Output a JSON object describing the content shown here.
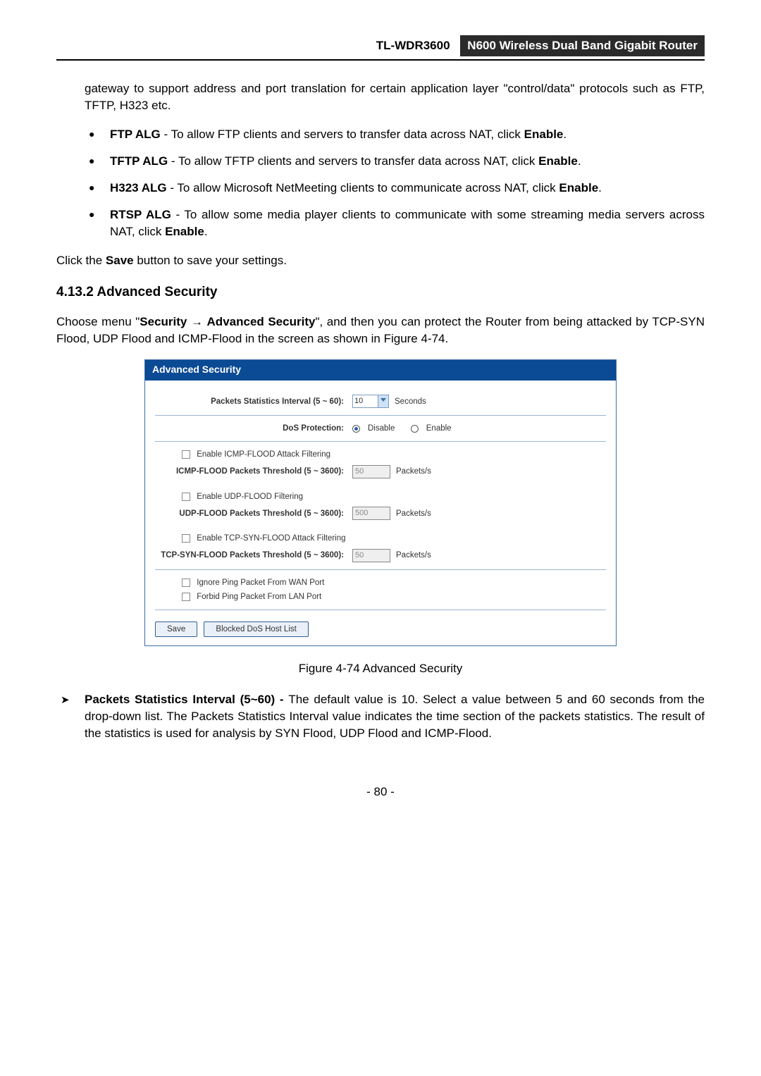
{
  "header": {
    "model": "TL-WDR3600",
    "title": "N600 Wireless Dual Band Gigabit Router"
  },
  "intro_para": "gateway to support address and port translation for certain application layer \"control/data\" protocols such as FTP, TFTP, H323 etc.",
  "alg_items": [
    {
      "bold": "FTP ALG",
      "rest": " - To allow FTP clients and servers to transfer data across NAT, click ",
      "bold2": "Enable",
      "tail": "."
    },
    {
      "bold": "TFTP ALG",
      "rest": " - To allow TFTP clients and servers to transfer data across NAT, click ",
      "bold2": "Enable",
      "tail": "."
    },
    {
      "bold": "H323 ALG",
      "rest": " - To allow Microsoft NetMeeting clients to communicate across NAT, click ",
      "bold2": "Enable",
      "tail": "."
    },
    {
      "bold": "RTSP ALG",
      "rest": " - To allow some media player clients to communicate with some streaming media servers across NAT, click ",
      "bold2": "Enable",
      "tail": "."
    }
  ],
  "save_line": {
    "pre": "Click the ",
    "bold": "Save",
    "post": " button to save your settings."
  },
  "section_heading": "4.13.2  Advanced Security",
  "choose_menu": {
    "pre": "Choose menu \"",
    "b1": "Security",
    "arrow": " → ",
    "b2": "Advanced Security",
    "post": "\", and then you can protect the Router from being attacked by TCP-SYN Flood, UDP Flood and ICMP-Flood in the screen as shown in Figure 4-74."
  },
  "shot": {
    "title": "Advanced Security",
    "stat_label": "Packets Statistics Interval (5 ~ 60):",
    "stat_value": "10",
    "stat_unit": "Seconds",
    "dos_label": "DoS Protection:",
    "dos_disable": "Disable",
    "dos_enable": "Enable",
    "icmp_enable": "Enable ICMP-FLOOD Attack Filtering",
    "icmp_thresh_label": "ICMP-FLOOD Packets Threshold (5 ~ 3600):",
    "icmp_thresh_value": "50",
    "pkts": "Packets/s",
    "udp_enable": "Enable UDP-FLOOD Filtering",
    "udp_thresh_label": "UDP-FLOOD Packets Threshold (5 ~ 3600):",
    "udp_thresh_value": "500",
    "tcp_enable": "Enable TCP-SYN-FLOOD Attack Filtering",
    "tcp_thresh_label": "TCP-SYN-FLOOD Packets Threshold (5 ~ 3600):",
    "tcp_thresh_value": "50",
    "ignore_wan": "Ignore Ping Packet From WAN Port",
    "forbid_lan": "Forbid Ping Packet From LAN Port",
    "btn_save": "Save",
    "btn_blocked": "Blocked DoS Host List"
  },
  "figure_caption": "Figure 4-74 Advanced Security",
  "packets_item": {
    "bold": "Packets Statistics Interval (5~60) - ",
    "rest": "The default value is 10. Select a value between 5 and 60 seconds from the drop-down list. The Packets Statistics Interval value indicates the time section of the packets statistics. The result of the statistics is used for analysis by SYN Flood, UDP Flood and ICMP-Flood."
  },
  "page_number": "- 80 -"
}
